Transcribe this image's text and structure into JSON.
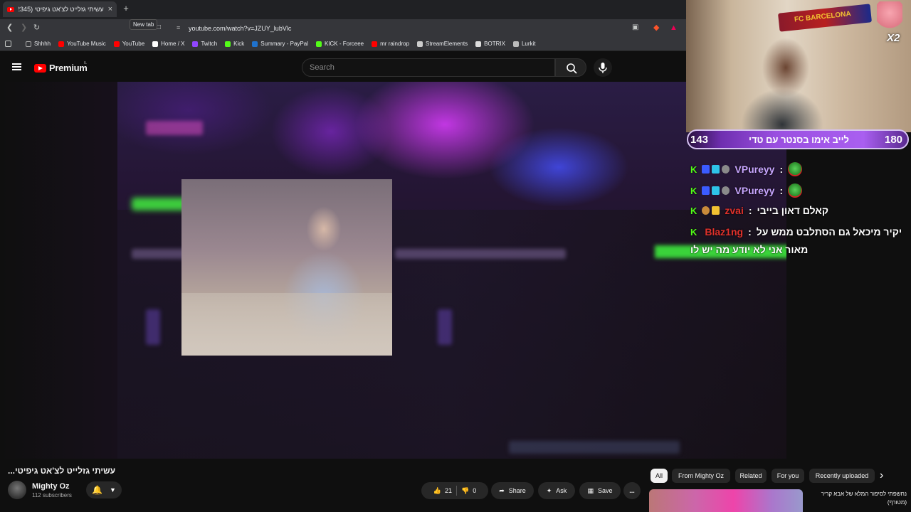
{
  "browser": {
    "tab_title": "עשיתי גזלייט לצ'אט גיפיטי (2345)",
    "tab_close": "×",
    "new_tab_plus": "+",
    "tooltip": "New tab",
    "url": "youtube.com/watch?v=JZUY_lubVlc",
    "bookmarks": [
      {
        "label": "Shhhh",
        "icon": "folder-icon",
        "color": "#aaaaaa"
      },
      {
        "label": "YouTube Music",
        "icon": "youtube-music-icon",
        "color": "#ff0000"
      },
      {
        "label": "YouTube",
        "icon": "youtube-icon",
        "color": "#ff0000"
      },
      {
        "label": "Home / X",
        "icon": "x-icon",
        "color": "#ffffff"
      },
      {
        "label": "Twitch",
        "icon": "twitch-icon",
        "color": "#9146ff"
      },
      {
        "label": "Kick",
        "icon": "kick-icon",
        "color": "#53fc18"
      },
      {
        "label": "Summary - PayPal",
        "icon": "paypal-icon",
        "color": "#1f72cd"
      },
      {
        "label": "KICK - Forceee",
        "icon": "kick-icon",
        "color": "#53fc18"
      },
      {
        "label": "mr raindrop",
        "icon": "youtube-icon",
        "color": "#ff0000"
      },
      {
        "label": "StreamElements",
        "icon": "streamelements-icon",
        "color": "#cccccc"
      },
      {
        "label": "BOTRIX",
        "icon": "botrix-icon",
        "color": "#dddddd"
      },
      {
        "label": "Lurkit",
        "icon": "lurkit-icon",
        "color": "#bbbbbb"
      }
    ]
  },
  "youtube": {
    "logo_text": "Premium",
    "country_code": "IL",
    "search_placeholder": "Search",
    "video_title": "עשיתי גזלייט לצ'אט גיפיטי...",
    "channel_name": "Mighty Oz",
    "channel_subs": "112 subscribers",
    "likes": "21",
    "dislikes": "0",
    "share_label": "Share",
    "ask_label": "Ask",
    "save_label": "Save",
    "more_label": "...",
    "chips": [
      "All",
      "From Mighty Oz",
      "Related",
      "For you",
      "Recently uploaded"
    ],
    "chips_next": "›",
    "recommended_title": "נחשפתי לסיפור המלא של אבא קריר (מטורף)"
  },
  "stream_overlay": {
    "banner": "FC BARCELONA",
    "multiplier": "X2",
    "goal_left": "143",
    "goal_right": "180",
    "goal_label": "לייב אימו בסנטר עם טדי",
    "chat": [
      {
        "user": "VPureyy",
        "user_color": "#c8a6ff",
        "message": ""
      },
      {
        "user": "VPureyy",
        "user_color": "#c8a6ff",
        "message": ""
      },
      {
        "user": "zvai",
        "user_color": "#e0312b",
        "message": "קאלם דאון בייבי"
      },
      {
        "user": "Blaz1ng",
        "user_color": "#e0312b",
        "message": "יקיר מיכאל גם הסתלבט ממש על"
      },
      {
        "user": "",
        "user_color": "#ffffff",
        "message": "מאור אני לא יודע מה יש לו"
      }
    ],
    "chat_separator": ":"
  }
}
